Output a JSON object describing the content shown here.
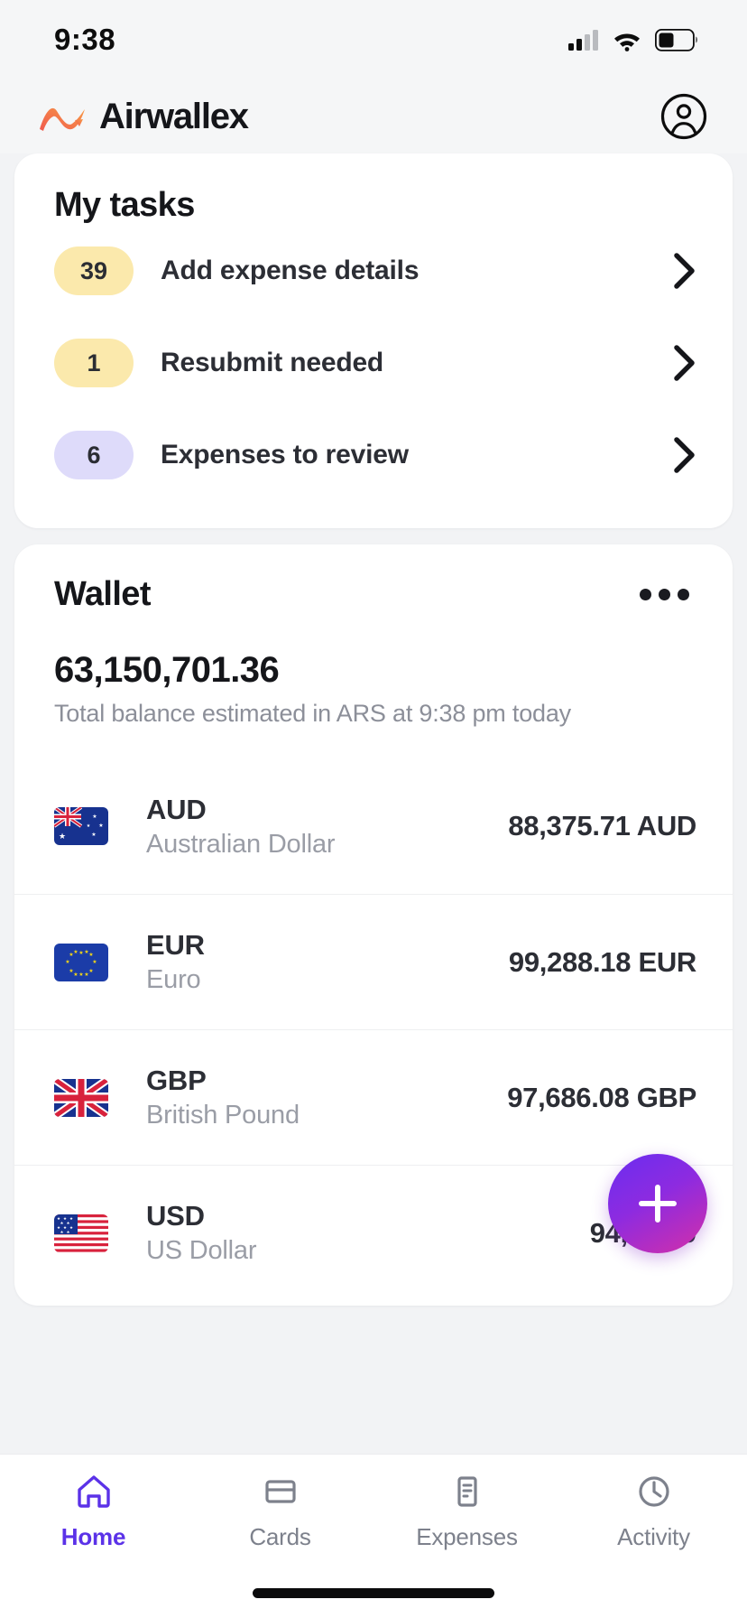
{
  "status_bar": {
    "time": "9:38",
    "icons": [
      "cellular-signal-icon",
      "wifi-icon",
      "battery-icon"
    ]
  },
  "header": {
    "brand_name": "Airwallex",
    "logo_icon": "airwallex-logo-icon",
    "account_icon": "account-circle-icon"
  },
  "tasks_card": {
    "title": "My tasks",
    "items": [
      {
        "count": "39",
        "label": "Add expense details",
        "badge_color": "#fbe9ac",
        "chevron": "chevron-right-icon"
      },
      {
        "count": "1",
        "label": "Resubmit needed",
        "badge_color": "#fbe9ac",
        "chevron": "chevron-right-icon"
      },
      {
        "count": "6",
        "label": "Expenses to review",
        "badge_color": "#dedbfa",
        "chevron": "chevron-right-icon"
      }
    ]
  },
  "wallet_card": {
    "title": "Wallet",
    "more_icon": "more-horizontal-icon",
    "total_balance": "63,150,701.36",
    "balance_subtitle": "Total balance estimated in ARS at 9:38 pm today",
    "currencies": [
      {
        "code": "AUD",
        "name": "Australian Dollar",
        "amount": "88,375.71 AUD",
        "flag_icon": "flag-australia-icon"
      },
      {
        "code": "EUR",
        "name": "Euro",
        "amount": "99,288.18 EUR",
        "flag_icon": "flag-european-union-icon"
      },
      {
        "code": "GBP",
        "name": "British Pound",
        "amount": "97,686.08 GBP",
        "flag_icon": "flag-united-kingdom-icon"
      },
      {
        "code": "USD",
        "name": "US Dollar",
        "amount": "94,226.0",
        "flag_icon": "flag-united-states-icon"
      }
    ]
  },
  "fab": {
    "icon": "plus-icon",
    "gradient_from": "#6a2df0",
    "gradient_to": "#d42fa8"
  },
  "bottom_nav": {
    "active_color": "#5b32e8",
    "inactive_color": "#7d818c",
    "items": [
      {
        "label": "Home",
        "icon": "home-icon"
      },
      {
        "label": "Cards",
        "icon": "card-icon"
      },
      {
        "label": "Expenses",
        "icon": "receipt-icon"
      },
      {
        "label": "Activity",
        "icon": "clock-icon"
      }
    ]
  }
}
